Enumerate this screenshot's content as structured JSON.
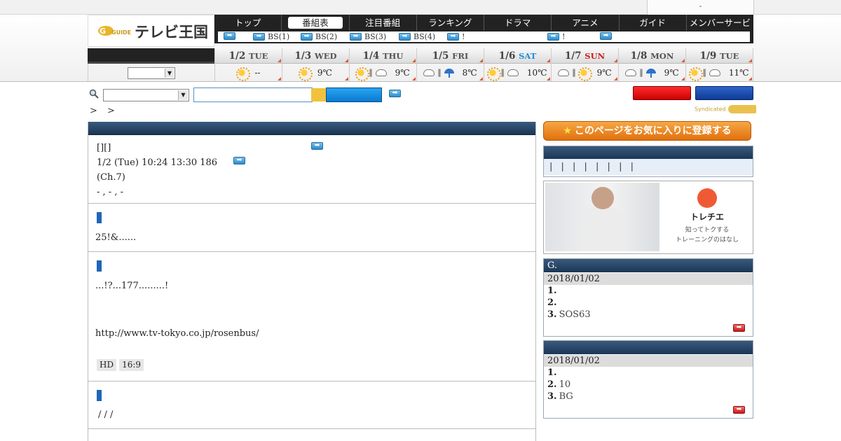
{
  "header": {
    "utility_text": "-",
    "site_name": "テレビ王国"
  },
  "nav": {
    "items": [
      "トップ",
      "番組表",
      "注目番組",
      "ランキング",
      "ドラマ",
      "アニメ",
      "ガイド",
      "メンバーサービス"
    ],
    "active_index": 1,
    "sub_items": [
      "",
      "BS(1)",
      "BS(2)",
      "BS(3)",
      "BS(4)",
      "!",
      "!",
      ""
    ]
  },
  "weather": {
    "days": [
      {
        "date": "1/2",
        "dow": "TUE",
        "temp": "--",
        "icons": [
          "sun"
        ]
      },
      {
        "date": "1/3",
        "dow": "WED",
        "temp": "9℃",
        "icons": [
          "sun"
        ]
      },
      {
        "date": "1/4",
        "dow": "THU",
        "temp": "9℃",
        "icons": [
          "sun",
          "cloud"
        ]
      },
      {
        "date": "1/5",
        "dow": "FRI",
        "temp": "8℃",
        "icons": [
          "cloud",
          "umbrella"
        ]
      },
      {
        "date": "1/6",
        "dow": "SAT",
        "temp": "10℃",
        "icons": [
          "sun",
          "cloud"
        ]
      },
      {
        "date": "1/7",
        "dow": "SUN",
        "temp": "9℃",
        "icons": [
          "cloud",
          "sun"
        ]
      },
      {
        "date": "1/8",
        "dow": "MON",
        "temp": "9℃",
        "icons": [
          "cloud",
          "umbrella"
        ]
      },
      {
        "date": "1/9",
        "dow": "TUE",
        "temp": "11℃",
        "icons": [
          "sun",
          "cloud"
        ]
      }
    ]
  },
  "search": {
    "placeholder": ""
  },
  "breadcrumb": "> >",
  "program": {
    "line1": "[][]",
    "line2": "1/2 (Tue) 10:24  13:30 186",
    "line3": "(Ch.7)",
    "line4": " - ,  -      ,  -"
  },
  "sections": [
    {
      "text": "25!&......"
    },
    {
      "text": "...!?...177.........!",
      "url": "http://www.tv-tokyo.co.jp/rosenbus/",
      "tags": [
        "HD",
        "16:9",
        ""
      ]
    },
    {
      "text": "/  /  /"
    }
  ],
  "sidebar": {
    "favorite_label": "このページをお気に入りに登録する",
    "category_row": "| | | | | | | |",
    "ad": {
      "title": "トレチエ",
      "sub1": "知ってトクする",
      "sub2": "トレーニングのはなし"
    },
    "ranking1": {
      "header": "G.",
      "date": "2018/01/02",
      "items": [
        {
          "rank": "1.",
          "text": ""
        },
        {
          "rank": "2.",
          "text": ""
        },
        {
          "rank": "3.",
          "text": "SOS63"
        }
      ]
    },
    "ranking2": {
      "header": "",
      "date": "2018/01/02",
      "items": [
        {
          "rank": "1.",
          "text": ""
        },
        {
          "rank": "2.",
          "text": "10"
        },
        {
          "rank": "3.",
          "text": "BG"
        }
      ]
    }
  },
  "syndicated_label": "Syndicated",
  "colors": {
    "nav_bg": "#222222",
    "section_head": "#1b3656",
    "accent_orange": "#e0700d",
    "accent_blue": "#1f66b8"
  }
}
